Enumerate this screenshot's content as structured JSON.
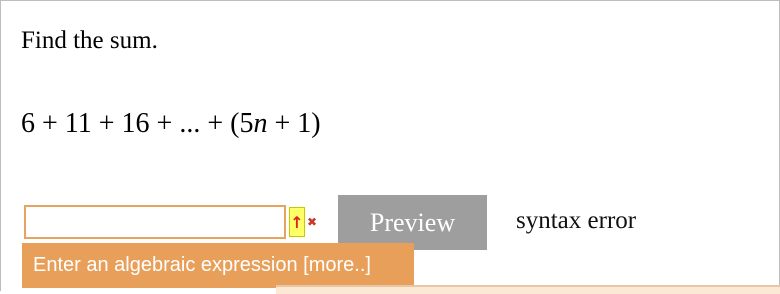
{
  "question": {
    "prompt": "Find the sum.",
    "equation": {
      "prefix": "6 + 11 + 16 + ... + (5",
      "variable": "n",
      "suffix": " + 1)"
    }
  },
  "answer": {
    "value": "",
    "placeholder": ""
  },
  "controls": {
    "arrow_label": "↑",
    "error_mark": "✖",
    "preview_label": "Preview",
    "status_text": "syntax error"
  },
  "hint": {
    "text": "Enter an algebraic expression [more..]"
  },
  "colors": {
    "hint_bg": "#e89f5a",
    "preview_bg": "#9e9e9e",
    "arrow_bg": "#ffff66"
  }
}
